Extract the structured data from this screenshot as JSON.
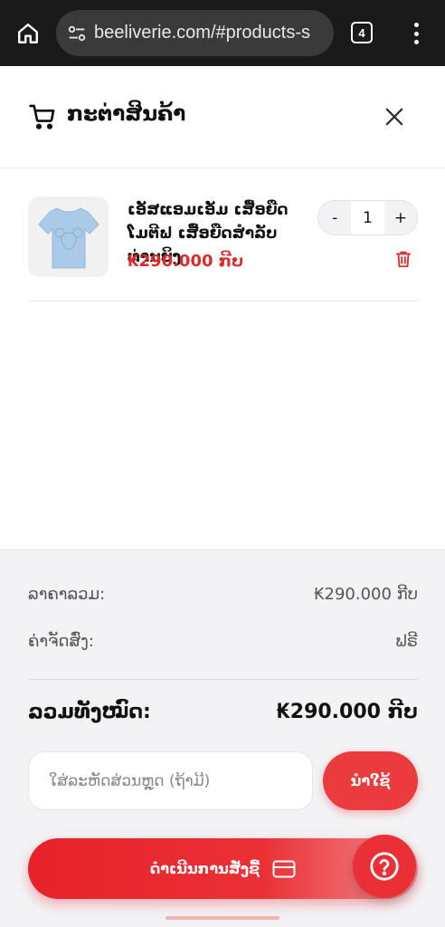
{
  "browser": {
    "url": "beeliverie.com/#products-s",
    "tab_count": "4"
  },
  "cart": {
    "title": "ກະຕ່າສິນຄ້າ"
  },
  "item": {
    "name": "ເອັສແອມເອັມ ເສື້ອຍືດ ໂມຕີຟ ເສື້ອຍືດສຳລັບທ່ານຍິງ",
    "price": "₭290.000 ກີບ",
    "quantity": "1",
    "minus_label": "-",
    "plus_label": "+"
  },
  "summary": {
    "subtotal_label": "ລາຄາລວມ:",
    "subtotal_value": "₭290.000 ກີບ",
    "shipping_label": "ຄ່າຈັດສົ່ງ:",
    "shipping_value": "ຟຣີ",
    "total_label": "ລວມທັງໝົດ:",
    "total_value": "₭290.000 ກີບ"
  },
  "coupon": {
    "placeholder": "ໃສ່ລະຫັດສ່ວນຫຼຸດ (ຖ້າມີ)",
    "apply_label": "ນຳໃຊ້"
  },
  "checkout": {
    "label": "ດຳເນີນການສັ່ງຊື້"
  },
  "colors": {
    "accent": "#ec3b3f",
    "price": "#e02a2a"
  }
}
